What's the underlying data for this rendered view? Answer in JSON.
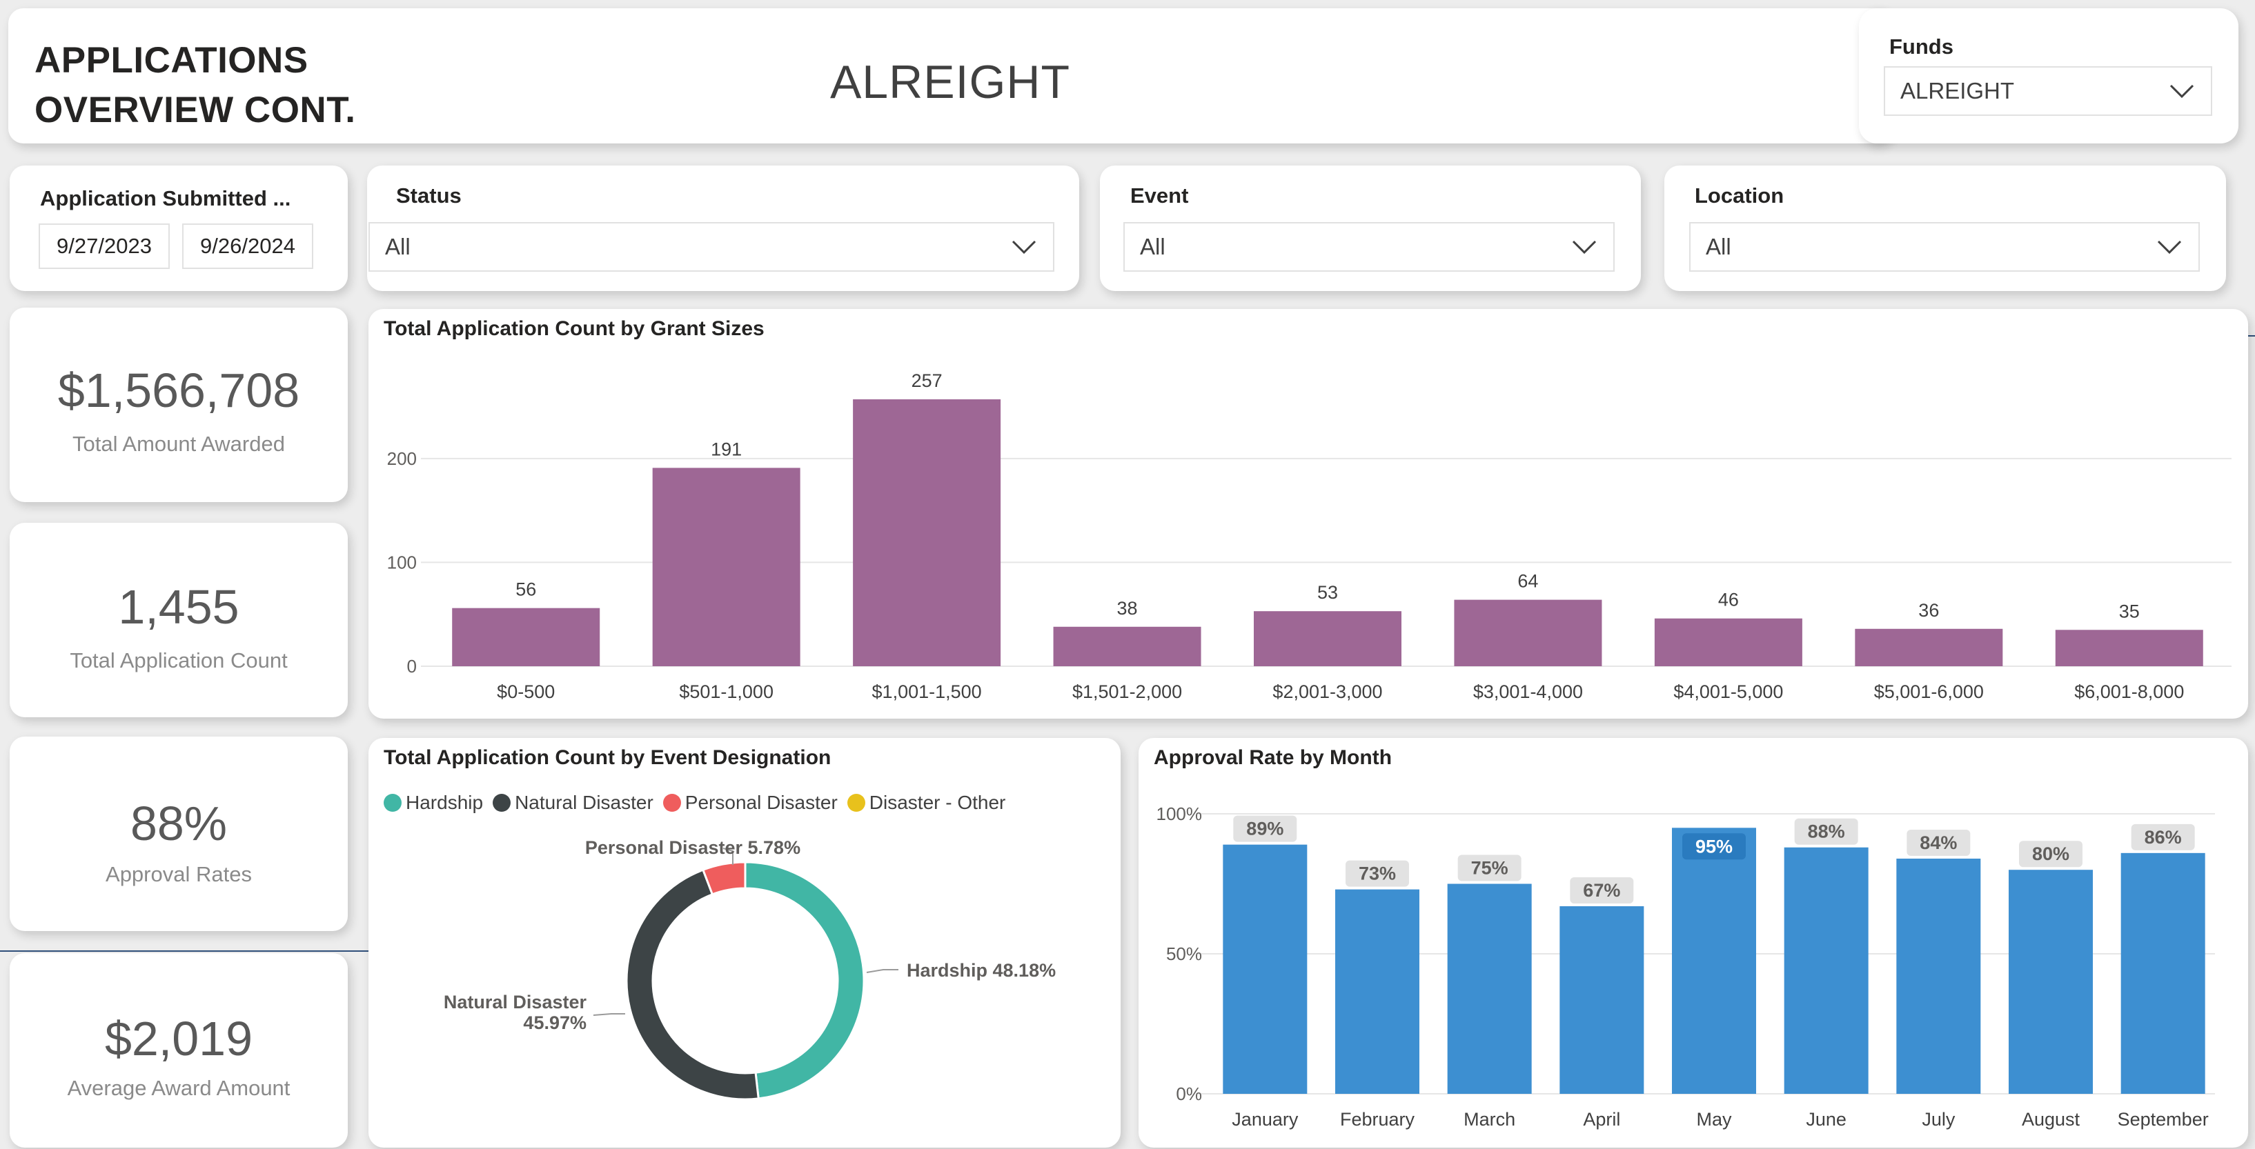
{
  "header": {
    "title_line1": "APPLICATIONS",
    "title_line2": "OVERVIEW CONT.",
    "fund_name": "ALREIGHT"
  },
  "funds_slicer": {
    "title": "Funds",
    "selected": "ALREIGHT"
  },
  "date_slicer": {
    "title": "Application Submitted ...",
    "start": "9/27/2023",
    "end": "9/26/2024"
  },
  "status_slicer": {
    "title": "Status",
    "selected": "All"
  },
  "event_slicer": {
    "title": "Event",
    "selected": "All"
  },
  "location_slicer": {
    "title": "Location",
    "selected": "All"
  },
  "kpis": {
    "awarded": {
      "value": "$1,566,708",
      "label": "Total Amount Awarded"
    },
    "count": {
      "value": "1,455",
      "label": "Total Application Count"
    },
    "approval": {
      "value": "88%",
      "label": "Approval Rates"
    },
    "average": {
      "value": "$2,019",
      "label": "Average Award Amount"
    }
  },
  "colors": {
    "purple": "#9e6795",
    "blue": "#3d8fd1",
    "teal": "#41b6a5",
    "dark": "#3d4446",
    "red": "#ef5d5d",
    "yellow": "#e8c11c"
  },
  "chart_data": [
    {
      "type": "bar",
      "title": "Total Application Count by Grant Sizes",
      "categories": [
        "$0-500",
        "$501-1,000",
        "$1,001-1,500",
        "$1,501-2,000",
        "$2,001-3,000",
        "$3,001-4,000",
        "$4,001-5,000",
        "$5,001-6,000",
        "$6,001-8,000"
      ],
      "values": [
        56,
        191,
        257,
        38,
        53,
        64,
        46,
        36,
        35
      ],
      "yticks": [
        "0",
        "100",
        "200"
      ],
      "ylim": [
        0,
        257
      ],
      "grid": true
    },
    {
      "type": "pie",
      "title": "Total Application Count by Event Designation",
      "legend": [
        "Hardship",
        "Natural Disaster",
        "Personal Disaster",
        "Disaster - Other"
      ],
      "slices": [
        {
          "name": "Hardship",
          "value": 48.18,
          "label": "Hardship 48.18%"
        },
        {
          "name": "Natural Disaster",
          "value": 45.97,
          "label_line1": "Natural Disaster",
          "label_line2": "45.97%"
        },
        {
          "name": "Personal Disaster",
          "value": 5.78,
          "label": "Personal Disaster 5.78%"
        }
      ],
      "legend_position": "top-left"
    },
    {
      "type": "bar",
      "title": "Approval Rate by Month",
      "categories": [
        "January",
        "February",
        "March",
        "April",
        "May",
        "June",
        "July",
        "August",
        "September"
      ],
      "values": [
        89,
        73,
        75,
        67,
        95,
        88,
        84,
        80,
        86
      ],
      "labels": [
        "89%",
        "73%",
        "75%",
        "67%",
        "95%",
        "88%",
        "84%",
        "80%",
        "86%"
      ],
      "yticks": [
        "0%",
        "50%",
        "100%"
      ],
      "ylim": [
        0,
        100
      ],
      "grid": true
    }
  ]
}
